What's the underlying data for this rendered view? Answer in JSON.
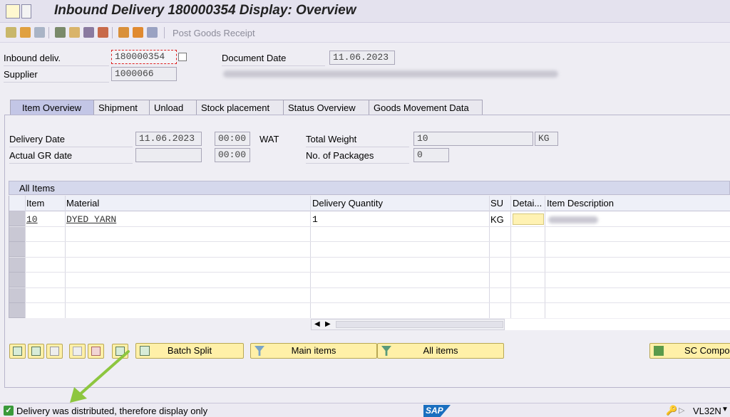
{
  "window": {
    "title": "Inbound Delivery 180000354 Display: Overview"
  },
  "toolbar": {
    "post_gi_label": "Post Goods Receipt"
  },
  "header": {
    "inbound_label": "Inbound deliv.",
    "inbound_value": "180000354",
    "supplier_label": "Supplier",
    "supplier_value": "1000066",
    "docdate_label": "Document Date",
    "docdate_value": "11.06.2023"
  },
  "tabs": [
    {
      "label": "Item Overview",
      "active": true
    },
    {
      "label": "Shipment"
    },
    {
      "label": "Unload"
    },
    {
      "label": "Stock placement"
    },
    {
      "label": "Status Overview"
    },
    {
      "label": "Goods Movement Data"
    }
  ],
  "overview": {
    "delivery_date_label": "Delivery Date",
    "delivery_date_value": "11.06.2023",
    "delivery_time_value": "00:00",
    "tz": "WAT",
    "actual_gr_label": "Actual GR date",
    "actual_gr_value": "",
    "actual_gr_time": "00:00",
    "total_weight_label": "Total Weight",
    "total_weight_value": "10",
    "weight_unit": "KG",
    "packages_label": "No. of Packages",
    "packages_value": "0"
  },
  "items_table": {
    "title": "All Items",
    "columns": [
      "Item",
      "Material",
      "Delivery Quantity",
      "SU",
      "Detai...",
      "Item Description"
    ],
    "rows": [
      {
        "item": "10",
        "material": "DYED YARN",
        "qty": "1",
        "su": "KG",
        "detail": "",
        "description": ""
      }
    ]
  },
  "buttons": {
    "batch_split": "Batch Split",
    "main_items": "Main items",
    "all_items": "All items",
    "sc_compon": "SC Compon"
  },
  "status": {
    "message": "Delivery was distributed, therefore display only",
    "logo": "SAP",
    "transaction": "VL32N"
  },
  "colors": {
    "accent": "#1a6fbf",
    "button": "#fff0a8",
    "tab_active": "#c3c6e6",
    "arrow": "#8dc63f"
  }
}
